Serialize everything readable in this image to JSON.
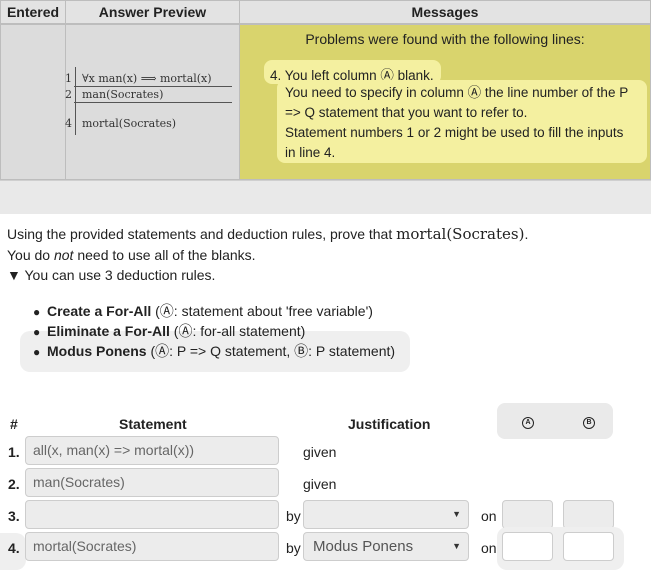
{
  "feedback": {
    "headers": {
      "entered": "Entered",
      "preview": "Answer Preview",
      "messages": "Messages"
    },
    "preview_lines": [
      {
        "num": "1",
        "text": "∀x man(x) ⟹ mortal(x)"
      },
      {
        "num": "2",
        "text": "man(Socrates)"
      },
      {
        "num": "4",
        "text": "mortal(Socrates)"
      }
    ],
    "message_title": "Problems were found with the following lines:",
    "message_item_label": "4. You left column Ⓐ blank.",
    "message_detail": [
      "You need to specify in column Ⓐ the line number of the P",
      "=> Q statement that you want to refer to.",
      "Statement numbers 1 or 2 might be used to fill the inputs",
      "in line 4."
    ]
  },
  "problem": {
    "intro_prefix": "Using the provided statements and deduction rules, prove that ",
    "intro_math": "mortal(Socrates)",
    "intro_suffix": ".",
    "line2_prefix": "You do ",
    "line2_em": "not",
    "line2_suffix": " need to use all of the blanks.",
    "rules_toggle": "▼ You can use 3 deduction rules.",
    "rules": [
      {
        "name": "Create a For-All",
        "desc": " (Ⓐ: statement about 'free variable')"
      },
      {
        "name": "Eliminate a For-All",
        "desc": " (Ⓐ: for-all statement)"
      },
      {
        "name": "Modus Ponens",
        "desc": " (Ⓐ: P => Q statement, Ⓑ: P statement)"
      }
    ]
  },
  "proof": {
    "headers": {
      "num": "#",
      "statement": "Statement",
      "justification": "Justification",
      "col_a": "A",
      "col_b": "B"
    },
    "rows": [
      {
        "num": "1.",
        "statement": "all(x, man(x) => mortal(x))",
        "justification": "given"
      },
      {
        "num": "2.",
        "statement": "man(Socrates)",
        "justification": "given"
      },
      {
        "num": "3.",
        "statement": "",
        "by": "by",
        "rule": "",
        "on": "on"
      },
      {
        "num": "4.",
        "statement": "mortal(Socrates)",
        "by": "by",
        "rule": "Modus Ponens",
        "on": "on"
      }
    ]
  },
  "icons": {
    "select_caret": "▼"
  }
}
